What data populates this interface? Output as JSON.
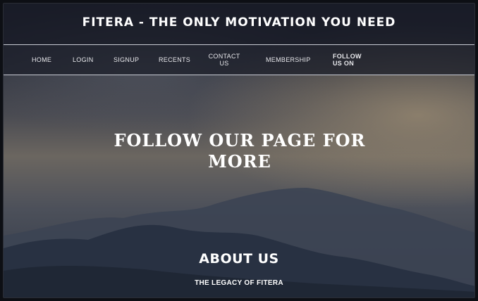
{
  "header": {
    "title": "FITERA - THE ONLY MOTIVATION YOU NEED"
  },
  "nav": {
    "items": [
      {
        "label": "HOME"
      },
      {
        "label": "LOGIN"
      },
      {
        "label": "SIGNUP"
      },
      {
        "label": "RECENTS"
      },
      {
        "label": "CONTACT US"
      },
      {
        "label": "MEMBERSHIP"
      },
      {
        "label": "FOLLOW US ON"
      }
    ]
  },
  "hero": {
    "heading": "FOLLOW OUR PAGE FOR MORE"
  },
  "about": {
    "title": "ABOUT US",
    "subtitle": "THE LEGACY OF FITERA"
  },
  "colors": {
    "text": "#ffffff",
    "nav_border": "#c9ccd4",
    "header_bg": "#181b26"
  }
}
